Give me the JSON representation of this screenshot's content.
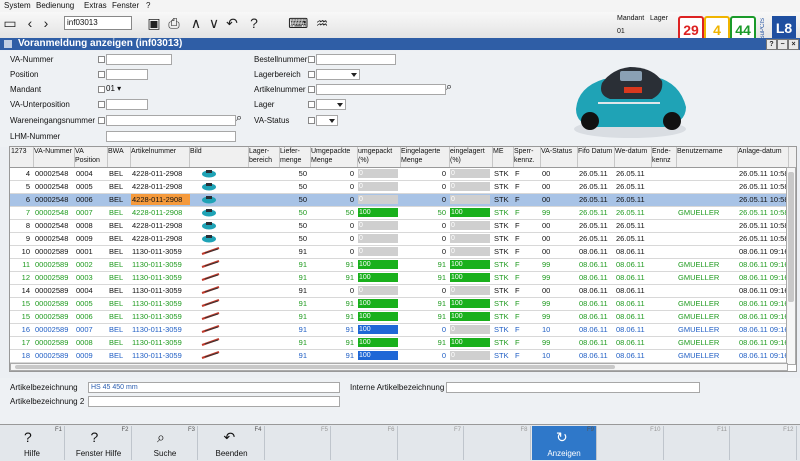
{
  "menu": [
    "System",
    "Bedienung",
    "Extras",
    "Fenster",
    "?"
  ],
  "toolbar": {
    "doc_input": "inf03013",
    "mandant_label": "Mandant",
    "lager_label": "Lager",
    "mandant_value": "01",
    "badge1": "29",
    "badge2": "4",
    "badge3": "44",
    "logo": "L8",
    "logo_small": "SuPCIS"
  },
  "window": {
    "title": "Voranmeldung anzeigen (inf03013)",
    "btn_help": "?",
    "btn_min": "−",
    "btn_close": "×"
  },
  "form": {
    "va_nummer": "VA-Nummer",
    "position": "Position",
    "mandant": "Mandant",
    "mandant_value": "01",
    "va_unterposition": "VA-Unterposition",
    "wareneingangsnummer": "Wareneingangsnummer",
    "lhm_nummer": "LHM-Nummer",
    "bestellnummer": "Bestellnummer",
    "lagerbereich": "Lagerbereich",
    "artikelnummer": "Artikelnummer",
    "lager": "Lager",
    "va_status": "VA-Status"
  },
  "table": {
    "count": "1273",
    "headers": [
      "VA-Nummer",
      "VA Position",
      "BWA",
      "Artikelnummer",
      "Bild",
      "Lager-bereich",
      "Liefer-menge",
      "Umgepackte Menge",
      "umgepackt (%)",
      "Eingelagerte Menge",
      "eingelagert (%)",
      "ME",
      "Sperr-kennz.",
      "VA-Status",
      "Fifo Datum",
      "We-datum",
      "Ende-kennz",
      "Benutzername",
      "Anlage-datum"
    ],
    "rows": [
      {
        "n": "4",
        "va": "00002548",
        "pos": "0004",
        "bwa": "BEL",
        "art": "4228-011-2908",
        "lm": "50",
        "um": "0",
        "up": "0",
        "up_pct": 0,
        "em": "0",
        "ep": "0",
        "ep_pct": 0,
        "me": "STK",
        "sp": "F",
        "st": "00",
        "fifo": "26.05.11",
        "we": "26.05.11",
        "ende": "",
        "user": "",
        "anl": "26.05.11 10:58:",
        "color": "#111",
        "bg": "#ffffff",
        "upc": "#cfcfcf",
        "epc": "#cfcfcf",
        "img": "mower"
      },
      {
        "n": "5",
        "va": "00002548",
        "pos": "0005",
        "bwa": "BEL",
        "art": "4228-011-2908",
        "lm": "50",
        "um": "0",
        "up": "0",
        "up_pct": 0,
        "em": "0",
        "ep": "0",
        "ep_pct": 0,
        "me": "STK",
        "sp": "F",
        "st": "00",
        "fifo": "26.05.11",
        "we": "26.05.11",
        "ende": "",
        "user": "",
        "anl": "26.05.11 10:58:",
        "color": "#111",
        "bg": "#ffffff",
        "upc": "#cfcfcf",
        "epc": "#cfcfcf",
        "img": "mower"
      },
      {
        "n": "6",
        "va": "00002548",
        "pos": "0006",
        "bwa": "BEL",
        "art": "4228-011-2908",
        "lm": "50",
        "um": "0",
        "up": "0",
        "up_pct": 0,
        "em": "0",
        "ep": "0",
        "ep_pct": 0,
        "me": "STK",
        "sp": "F",
        "st": "00",
        "fifo": "26.05.11",
        "we": "26.05.11",
        "ende": "",
        "user": "",
        "anl": "26.05.11 10:58:",
        "color": "#111",
        "bg": "#a8c3e6",
        "upc": "#cfcfcf",
        "epc": "#cfcfcf",
        "img": "mower",
        "sel": true
      },
      {
        "n": "7",
        "va": "00002548",
        "pos": "0007",
        "bwa": "BEL",
        "art": "4228-011-2908",
        "lm": "50",
        "um": "50",
        "up": "100",
        "up_pct": 100,
        "em": "50",
        "ep": "100",
        "ep_pct": 100,
        "me": "STK",
        "sp": "F",
        "st": "99",
        "fifo": "26.05.11",
        "we": "26.05.11",
        "ende": "",
        "user": "GMUELLER",
        "anl": "26.05.11 10:58:",
        "color": "#1e9a1e",
        "bg": "#ffffff",
        "upc": "#19b01c",
        "epc": "#19b01c",
        "img": "mower"
      },
      {
        "n": "8",
        "va": "00002548",
        "pos": "0008",
        "bwa": "BEL",
        "art": "4228-011-2908",
        "lm": "50",
        "um": "0",
        "up": "0",
        "up_pct": 0,
        "em": "0",
        "ep": "0",
        "ep_pct": 0,
        "me": "STK",
        "sp": "F",
        "st": "00",
        "fifo": "26.05.11",
        "we": "26.05.11",
        "ende": "",
        "user": "",
        "anl": "26.05.11 10:58:",
        "color": "#111",
        "bg": "#ffffff",
        "upc": "#cfcfcf",
        "epc": "#cfcfcf",
        "img": "mower"
      },
      {
        "n": "9",
        "va": "00002548",
        "pos": "0009",
        "bwa": "BEL",
        "art": "4228-011-2908",
        "lm": "50",
        "um": "0",
        "up": "0",
        "up_pct": 0,
        "em": "0",
        "ep": "0",
        "ep_pct": 0,
        "me": "STK",
        "sp": "F",
        "st": "00",
        "fifo": "26.05.11",
        "we": "26.05.11",
        "ende": "",
        "user": "",
        "anl": "26.05.11 10:58:",
        "color": "#111",
        "bg": "#ffffff",
        "upc": "#cfcfcf",
        "epc": "#cfcfcf",
        "img": "mower"
      },
      {
        "n": "10",
        "va": "00002589",
        "pos": "0001",
        "bwa": "BEL",
        "art": "1130-011-3059",
        "lm": "91",
        "um": "0",
        "up": "0",
        "up_pct": 0,
        "em": "0",
        "ep": "0",
        "ep_pct": 0,
        "me": "STK",
        "sp": "F",
        "st": "00",
        "fifo": "08.06.11",
        "we": "08.06.11",
        "ende": "",
        "user": "",
        "anl": "08.06.11 09:16:",
        "color": "#111",
        "bg": "#ffffff",
        "upc": "#cfcfcf",
        "epc": "#cfcfcf",
        "img": "trimmer"
      },
      {
        "n": "11",
        "va": "00002589",
        "pos": "0002",
        "bwa": "BEL",
        "art": "1130-011-3059",
        "lm": "91",
        "um": "91",
        "up": "100",
        "up_pct": 100,
        "em": "91",
        "ep": "100",
        "ep_pct": 100,
        "me": "STK",
        "sp": "F",
        "st": "99",
        "fifo": "08.06.11",
        "we": "08.06.11",
        "ende": "",
        "user": "GMUELLER",
        "anl": "08.06.11 09:16:",
        "color": "#1e9a1e",
        "bg": "#ffffff",
        "upc": "#19b01c",
        "epc": "#19b01c",
        "img": "trimmer"
      },
      {
        "n": "12",
        "va": "00002589",
        "pos": "0003",
        "bwa": "BEL",
        "art": "1130-011-3059",
        "lm": "91",
        "um": "91",
        "up": "100",
        "up_pct": 100,
        "em": "91",
        "ep": "100",
        "ep_pct": 100,
        "me": "STK",
        "sp": "F",
        "st": "99",
        "fifo": "08.06.11",
        "we": "08.06.11",
        "ende": "",
        "user": "GMUELLER",
        "anl": "08.06.11 09:16:",
        "color": "#1e9a1e",
        "bg": "#ffffff",
        "upc": "#19b01c",
        "epc": "#19b01c",
        "img": "trimmer"
      },
      {
        "n": "14",
        "va": "00002589",
        "pos": "0004",
        "bwa": "BEL",
        "art": "1130-011-3059",
        "lm": "91",
        "um": "0",
        "up": "0",
        "up_pct": 0,
        "em": "0",
        "ep": "0",
        "ep_pct": 0,
        "me": "STK",
        "sp": "F",
        "st": "00",
        "fifo": "08.06.11",
        "we": "08.06.11",
        "ende": "",
        "user": "",
        "anl": "08.06.11 09:16:",
        "color": "#111",
        "bg": "#ffffff",
        "upc": "#cfcfcf",
        "epc": "#cfcfcf",
        "img": "trimmer"
      },
      {
        "n": "15",
        "va": "00002589",
        "pos": "0005",
        "bwa": "BEL",
        "art": "1130-011-3059",
        "lm": "91",
        "um": "91",
        "up": "100",
        "up_pct": 100,
        "em": "91",
        "ep": "100",
        "ep_pct": 100,
        "me": "STK",
        "sp": "F",
        "st": "99",
        "fifo": "08.06.11",
        "we": "08.06.11",
        "ende": "",
        "user": "GMUELLER",
        "anl": "08.06.11 09:16:",
        "color": "#1e9a1e",
        "bg": "#ffffff",
        "upc": "#19b01c",
        "epc": "#19b01c",
        "img": "trimmer"
      },
      {
        "n": "15",
        "va": "00002589",
        "pos": "0006",
        "bwa": "BEL",
        "art": "1130-011-3059",
        "lm": "91",
        "um": "91",
        "up": "100",
        "up_pct": 100,
        "em": "91",
        "ep": "100",
        "ep_pct": 100,
        "me": "STK",
        "sp": "F",
        "st": "99",
        "fifo": "08.06.11",
        "we": "08.06.11",
        "ende": "",
        "user": "GMUELLER",
        "anl": "08.06.11 09:16:",
        "color": "#1e9a1e",
        "bg": "#ffffff",
        "upc": "#19b01c",
        "epc": "#19b01c",
        "img": "trimmer"
      },
      {
        "n": "16",
        "va": "00002589",
        "pos": "0007",
        "bwa": "BEL",
        "art": "1130-011-3059",
        "lm": "91",
        "um": "91",
        "up": "100",
        "up_pct": 100,
        "em": "0",
        "ep": "0",
        "ep_pct": 0,
        "me": "STK",
        "sp": "F",
        "st": "10",
        "fifo": "08.06.11",
        "we": "08.06.11",
        "ende": "",
        "user": "GMUELLER",
        "anl": "08.06.11 09:16:",
        "color": "#1f5ec4",
        "bg": "#ffffff",
        "upc": "#1f67d6",
        "epc": "#cfcfcf",
        "img": "trimmer"
      },
      {
        "n": "17",
        "va": "00002589",
        "pos": "0008",
        "bwa": "BEL",
        "art": "1130-011-3059",
        "lm": "91",
        "um": "91",
        "up": "100",
        "up_pct": 100,
        "em": "91",
        "ep": "100",
        "ep_pct": 100,
        "me": "STK",
        "sp": "F",
        "st": "99",
        "fifo": "08.06.11",
        "we": "08.06.11",
        "ende": "",
        "user": "GMUELLER",
        "anl": "08.06.11 09:16:",
        "color": "#1e9a1e",
        "bg": "#ffffff",
        "upc": "#19b01c",
        "epc": "#19b01c",
        "img": "trimmer"
      },
      {
        "n": "18",
        "va": "00002589",
        "pos": "0009",
        "bwa": "BEL",
        "art": "1130-011-3059",
        "lm": "91",
        "um": "91",
        "up": "100",
        "up_pct": 100,
        "em": "0",
        "ep": "0",
        "ep_pct": 0,
        "me": "STK",
        "sp": "F",
        "st": "10",
        "fifo": "08.06.11",
        "we": "08.06.11",
        "ende": "",
        "user": "GMUELLER",
        "anl": "08.06.11 09:16:",
        "color": "#1f5ec4",
        "bg": "#ffffff",
        "upc": "#1f67d6",
        "epc": "#cfcfcf",
        "img": "trimmer"
      }
    ]
  },
  "bottom": {
    "artbez": "Artikelbezeichnung",
    "artbez_val": "HS 45 450 mm",
    "artbez2": "Artikelbezeichnung 2",
    "intern": "Interne Artikelbezeichnung"
  },
  "fkeys": [
    {
      "key": "F1",
      "label": "Hilfe",
      "icon": "?"
    },
    {
      "key": "F2",
      "label": "Fenster Hilfe",
      "icon": "?"
    },
    {
      "key": "F3",
      "label": "Suche",
      "icon": "⌕"
    },
    {
      "key": "F4",
      "label": "Beenden",
      "icon": "↶"
    },
    {
      "key": "F5",
      "label": "",
      "icon": ""
    },
    {
      "key": "F6",
      "label": "",
      "icon": ""
    },
    {
      "key": "F7",
      "label": "",
      "icon": ""
    },
    {
      "key": "F8",
      "label": "",
      "icon": ""
    },
    {
      "key": "F9",
      "label": "Anzeigen",
      "icon": "↻",
      "active": true
    },
    {
      "key": "F10",
      "label": "",
      "icon": ""
    },
    {
      "key": "F11",
      "label": "",
      "icon": ""
    },
    {
      "key": "F12",
      "label": "",
      "icon": ""
    }
  ]
}
